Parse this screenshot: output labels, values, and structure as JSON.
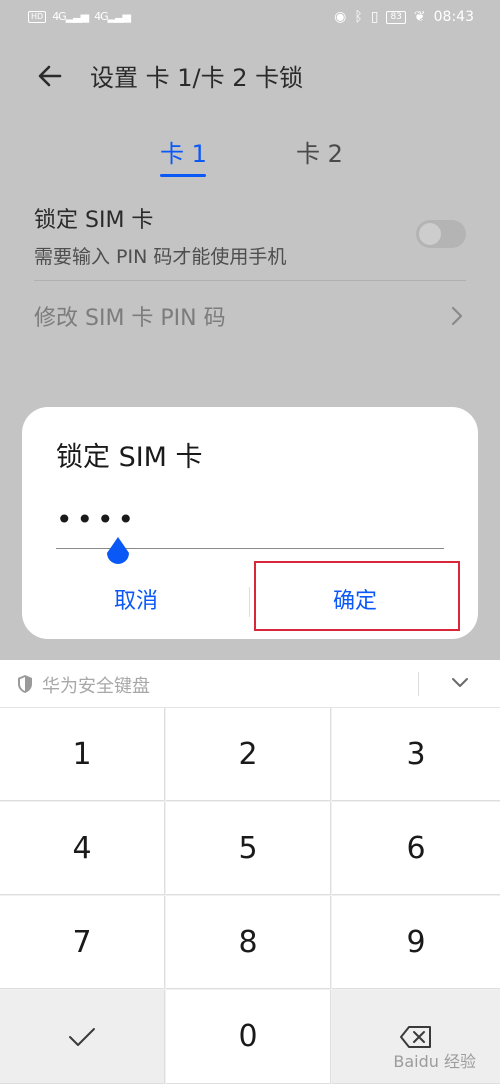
{
  "status_bar": {
    "left_badges": [
      "HD",
      "4G",
      "4G"
    ],
    "right_battery": "83",
    "right_time": "08:43"
  },
  "app_bar": {
    "title": "设置 卡 1/卡 2 卡锁"
  },
  "tabs": [
    {
      "label": "卡 1",
      "selected": true
    },
    {
      "label": "卡 2",
      "selected": false
    }
  ],
  "settings": {
    "lock_sim_title": "锁定 SIM 卡",
    "lock_sim_subtitle": "需要输入 PIN 码才能使用手机",
    "lock_sim_enabled": false,
    "change_pin_label": "修改 SIM 卡 PIN 码"
  },
  "dialog": {
    "title": "锁定 SIM 卡",
    "pin_masked": "••••",
    "cancel_label": "取消",
    "ok_label": "确定"
  },
  "keyboard": {
    "title": "华为安全键盘",
    "keys": [
      "1",
      "2",
      "3",
      "4",
      "5",
      "6",
      "7",
      "8",
      "9",
      "",
      "0",
      ""
    ]
  },
  "watermark": "Baidu 经验",
  "colors": {
    "accent": "#0a59f7",
    "highlight": "#d92638",
    "dim_background": "#c4c4c4"
  }
}
